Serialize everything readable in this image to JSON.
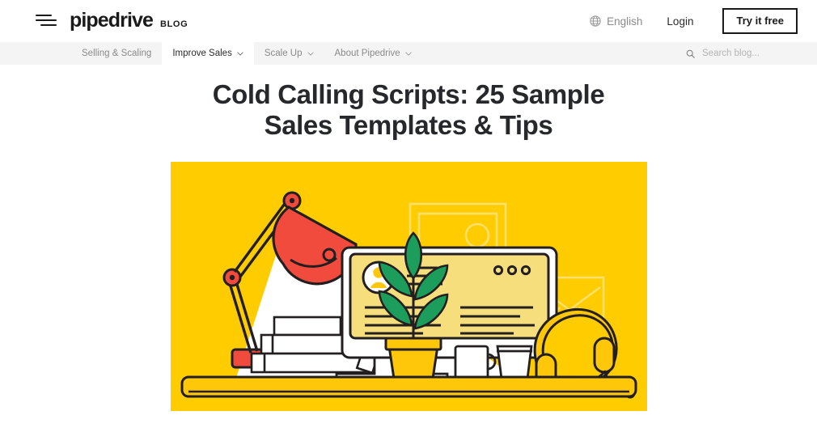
{
  "header": {
    "menu_icon": "hamburger-icon",
    "brand": "pipedrive",
    "brand_suffix": "BLOG",
    "language": "English",
    "language_icon": "globe-icon",
    "login": "Login",
    "cta": "Try it free"
  },
  "subnav": {
    "items": [
      {
        "label": "Selling & Scaling",
        "has_caret": false,
        "active": false
      },
      {
        "label": "Improve Sales",
        "has_caret": true,
        "active": true
      },
      {
        "label": "Scale Up",
        "has_caret": true,
        "active": false
      },
      {
        "label": "About Pipedrive",
        "has_caret": true,
        "active": false
      }
    ],
    "search_placeholder": "Search blog...",
    "search_value": "",
    "search_icon": "search-icon"
  },
  "article": {
    "title": "Cold Calling Scripts: 25 Sample Sales Templates & Tips",
    "hero_alt": "Illustration of a desk with a lamp, monitor, books, plant and headphones"
  },
  "colors": {
    "hero_background": "#FFCC00",
    "hero_screen": "#F7DE7D",
    "lamp_red": "#F04B3C",
    "plant_green": "#1D9D5B",
    "outline": "#231F20",
    "subnav_background": "#F4F4F4",
    "text_dark": "#26282B",
    "text_muted": "#8A8A8A"
  }
}
